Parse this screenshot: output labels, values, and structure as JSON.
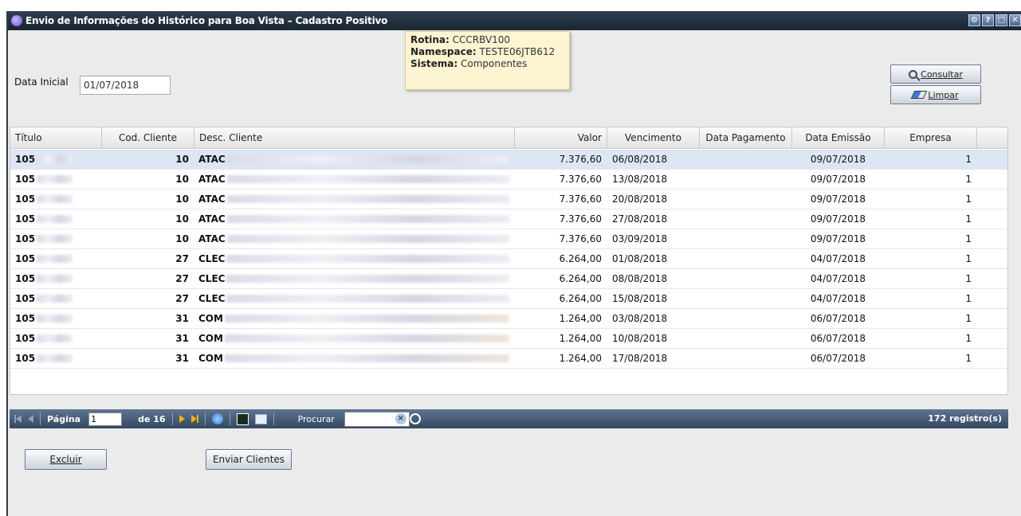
{
  "window": {
    "title": "Envio de Informações do Histórico para Boa Vista – Cadastro Positivo",
    "buttons": [
      "⚙",
      "?",
      "□",
      "✕"
    ]
  },
  "tooltip": {
    "rotina_label": "Rotina:",
    "rotina_value": "CCCRBV100",
    "namespace_label": "Namespace:",
    "namespace_value": "TESTE06JTB612",
    "sistema_label": "Sistema:",
    "sistema_value": "Componentes"
  },
  "filters": {
    "data_inicial_label": "Data Inicial",
    "data_inicial_value": "01/07/2018"
  },
  "actions": {
    "consultar_label": "Consultar",
    "limpar_label": "Limpar",
    "excluir_label": "Excluir",
    "enviar_label": "Enviar Clientes"
  },
  "grid": {
    "columns": [
      "Título",
      "Cod. Cliente",
      "Desc. Cliente",
      "Valor",
      "Vencimento",
      "Data Pagamento",
      "Data Emissão",
      "Empresa"
    ],
    "rows": [
      {
        "titulo": "105",
        "cod": "10",
        "desc": "ATAC",
        "valor": "7.376,60",
        "venc": "06/08/2018",
        "pag": "",
        "emissao": "09/07/2018",
        "empresa": "1"
      },
      {
        "titulo": "105",
        "cod": "10",
        "desc": "ATAC",
        "valor": "7.376,60",
        "venc": "13/08/2018",
        "pag": "",
        "emissao": "09/07/2018",
        "empresa": "1"
      },
      {
        "titulo": "105",
        "cod": "10",
        "desc": "ATAC",
        "valor": "7.376,60",
        "venc": "20/08/2018",
        "pag": "",
        "emissao": "09/07/2018",
        "empresa": "1"
      },
      {
        "titulo": "105",
        "cod": "10",
        "desc": "ATAC",
        "valor": "7.376,60",
        "venc": "27/08/2018",
        "pag": "",
        "emissao": "09/07/2018",
        "empresa": "1"
      },
      {
        "titulo": "105",
        "cod": "10",
        "desc": "ATAC",
        "valor": "7.376,60",
        "venc": "03/09/2018",
        "pag": "",
        "emissao": "09/07/2018",
        "empresa": "1"
      },
      {
        "titulo": "105",
        "cod": "27",
        "desc": "CLEC",
        "valor": "6.264,00",
        "venc": "01/08/2018",
        "pag": "",
        "emissao": "04/07/2018",
        "empresa": "1"
      },
      {
        "titulo": "105",
        "cod": "27",
        "desc": "CLEC",
        "valor": "6.264,00",
        "venc": "08/08/2018",
        "pag": "",
        "emissao": "04/07/2018",
        "empresa": "1"
      },
      {
        "titulo": "105",
        "cod": "27",
        "desc": "CLEC",
        "valor": "6.264,00",
        "venc": "15/08/2018",
        "pag": "",
        "emissao": "04/07/2018",
        "empresa": "1"
      },
      {
        "titulo": "105",
        "cod": "31",
        "desc": "COM",
        "valor": "1.264,00",
        "venc": "03/08/2018",
        "pag": "",
        "emissao": "06/07/2018",
        "empresa": "1"
      },
      {
        "titulo": "105",
        "cod": "31",
        "desc": "COM",
        "valor": "1.264,00",
        "venc": "10/08/2018",
        "pag": "",
        "emissao": "06/07/2018",
        "empresa": "1"
      },
      {
        "titulo": "105",
        "cod": "31",
        "desc": "COM",
        "valor": "1.264,00",
        "venc": "17/08/2018",
        "pag": "",
        "emissao": "06/07/2018",
        "empresa": "1"
      }
    ]
  },
  "pager": {
    "page_label": "Página",
    "page_value": "1",
    "of_label": "de 16",
    "search_label": "Procurar",
    "records": "172 registro(s)"
  }
}
